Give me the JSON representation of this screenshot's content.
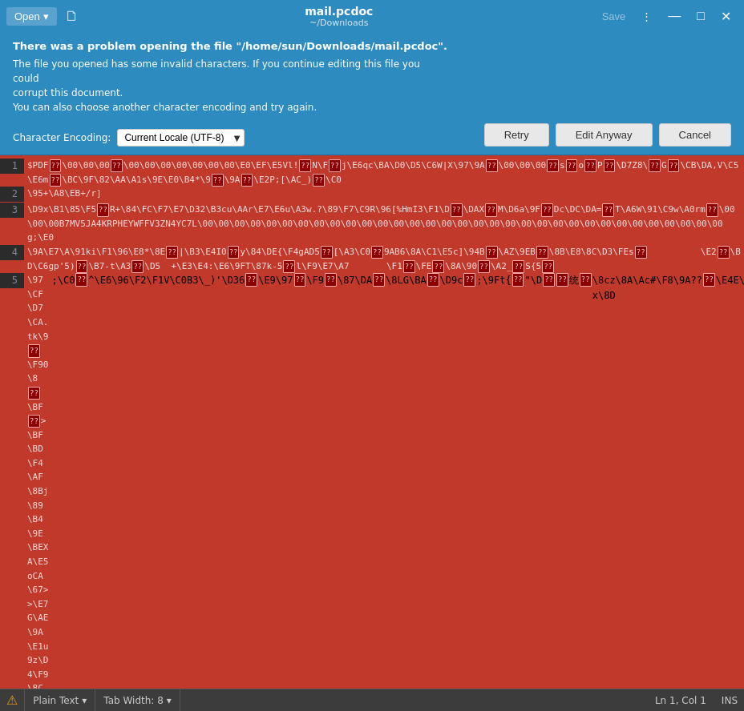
{
  "titlebar": {
    "open_label": "Open",
    "open_arrow": "▾",
    "filename": "mail.pcdoc",
    "filepath": "~/Downloads",
    "save_label": "Save",
    "more_icon": "⋮",
    "minimize_icon": "—",
    "maximize_icon": "□",
    "close_icon": "✕"
  },
  "error": {
    "header": "There was a problem opening the file \"/home/sun/Downloads/mail.pcdoc\".",
    "line1": "The file you opened has some invalid characters. If you continue editing this file you could",
    "line2": "corrupt this document.",
    "line3": "You can also choose another character encoding and try again.",
    "retry_label": "Retry",
    "edit_anyway_label": "Edit Anyway",
    "cancel_label": "Cancel",
    "encoding_label": "Character Encoding:",
    "encoding_value": "Current Locale (UTF-8)"
  },
  "statusbar": {
    "plain_text_label": "Plain Text",
    "tab_width_label": "Tab Width: 8",
    "position_label": "Ln 1, Col 1",
    "ins_label": "INS",
    "warning_icon": "⚠"
  }
}
